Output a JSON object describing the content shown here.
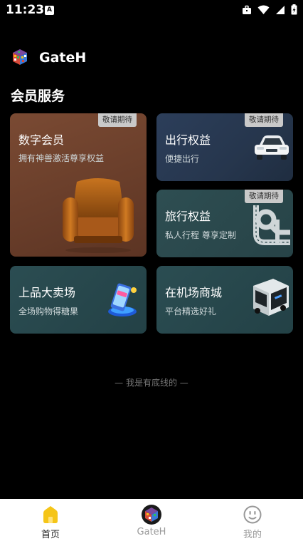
{
  "status_bar": {
    "time": "11:23",
    "notification_icon": "A"
  },
  "app": {
    "title": "GateH"
  },
  "section": {
    "title": "会员服务"
  },
  "cards": [
    {
      "title": "数字会员",
      "subtitle": "拥有神兽激活尊享权益",
      "badge": "敬请期待"
    },
    {
      "title": "出行权益",
      "subtitle": "便捷出行",
      "badge": "敬请期待"
    },
    {
      "title": "旅行权益",
      "subtitle": "私人行程 尊享定制",
      "badge": "敬请期待"
    },
    {
      "title": "上品大卖场",
      "subtitle": "全场购物得糖果"
    },
    {
      "title": "在机场商城",
      "subtitle": "平台精选好礼"
    }
  ],
  "footer_note": "— 我是有底线的 —",
  "bottom_nav": [
    {
      "label": "首页",
      "icon": "home-icon",
      "active": true
    },
    {
      "label": "GateH",
      "icon": "gateh-logo-icon",
      "active": false
    },
    {
      "label": "我的",
      "icon": "smiley-face-icon",
      "active": false
    }
  ],
  "colors": {
    "background": "#000000",
    "active_nav": "#f5c518",
    "nav_bg": "#ffffff"
  }
}
